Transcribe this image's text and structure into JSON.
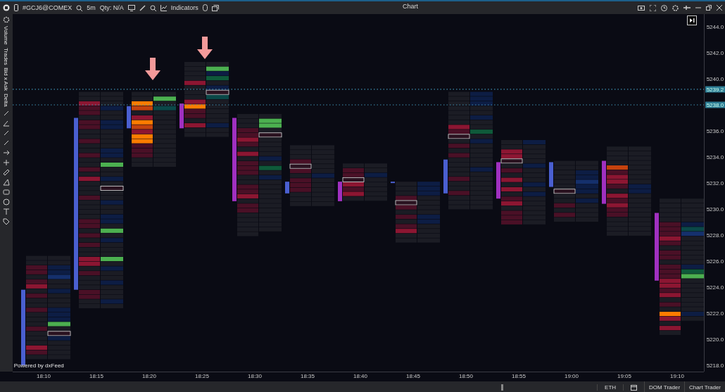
{
  "toolbar": {
    "symbol": "#GCJ6@COMEX",
    "interval": "5m",
    "quantity": "Qty: N/A",
    "indicators": "Indicators"
  },
  "window": {
    "title": "Chart"
  },
  "side_labels": [
    "Volume",
    "Trades",
    "Bid x Ask",
    "Delta"
  ],
  "price_axis": {
    "labels": [
      "5244.0",
      "5242.0",
      "5240.0",
      "5236.0",
      "5234.0",
      "5232.0",
      "5230.0",
      "5228.0",
      "5226.0",
      "5224.0",
      "5222.0",
      "5220.0",
      "5218.0"
    ],
    "markers": [
      "5239.2",
      "5238.0"
    ]
  },
  "time_axis": [
    "18:10",
    "18:15",
    "18:20",
    "18:25",
    "18:30",
    "18:35",
    "18:40",
    "18:45",
    "18:50",
    "18:55",
    "19:00",
    "19:05",
    "19:10"
  ],
  "bars": [
    {
      "color": "#4a5fd0"
    },
    {
      "color": "#4a5fd0"
    },
    {
      "color": "#4a5fd0"
    },
    {
      "color": "#a030c0"
    },
    {
      "color": "#a030c0"
    },
    {
      "color": "#4a5fd0"
    },
    {
      "color": "#a030c0"
    },
    {
      "color": "#4a5fd0"
    },
    {
      "color": "#4a5fd0"
    },
    {
      "color": "#a030c0"
    },
    {
      "color": "#4a5fd0"
    },
    {
      "color": "#a030c0"
    },
    {
      "color": "#a030c0"
    }
  ],
  "footer": {
    "credit": "Powered by dxFeed",
    "session": "ETH",
    "buttons": [
      "DOM Trader",
      "Chart Trader"
    ]
  }
}
